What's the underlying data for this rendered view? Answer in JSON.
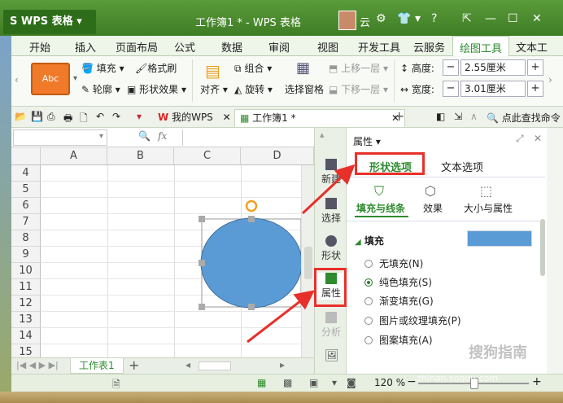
{
  "app": {
    "name": "WPS 表格",
    "doc_title": "工作簿1 * - WPS 表格",
    "user": "云"
  },
  "ribbon_tabs": [
    "开始",
    "插入",
    "页面布局",
    "公式",
    "数据",
    "审阅",
    "视图",
    "开发工具",
    "云服务",
    "绘图工具",
    "文本工"
  ],
  "active_tab": "绘图工具",
  "ribbon": {
    "style_preview": "Abc",
    "fill": "填充",
    "format_painter": "格式刷",
    "outline": "轮廓",
    "shape_effect": "形状效果",
    "align": "对齐",
    "group": "组合",
    "rotate": "旋转",
    "selection_pane": "选择窗格",
    "bring_forward": "上移一层",
    "send_backward": "下移一层",
    "height_label": "高度:",
    "height_value": "2.55厘米",
    "width_label": "宽度:",
    "width_value": "3.01厘米"
  },
  "doc_tabs": {
    "my_wps": "我的WPS",
    "workbook": "工作簿1 *",
    "search_cmd": "点此查找命令"
  },
  "formula_bar": {
    "fx": "fx"
  },
  "grid": {
    "columns": [
      "A",
      "B",
      "C",
      "D"
    ],
    "rows": [
      "4",
      "5",
      "6",
      "7",
      "8",
      "9",
      "10",
      "11",
      "12",
      "13",
      "14",
      "15"
    ]
  },
  "sheet_tab": "工作表1",
  "status": {
    "zoom": "120 %"
  },
  "side_toolbar": [
    "新建",
    "选择",
    "形状",
    "属性",
    "分析"
  ],
  "panel": {
    "title": "属性",
    "tab_shape": "形状选项",
    "tab_text": "文本选项",
    "sub_fill": "填充与线条",
    "sub_effect": "效果",
    "sub_size": "大小与属性",
    "section_fill": "填充",
    "fill_color": "#5b9bd5",
    "options": [
      "无填充(N)",
      "纯色填充(S)",
      "渐变填充(G)",
      "图片或纹理填充(P)",
      "图案填充(A)"
    ],
    "selected_option": "纯色填充(S)"
  },
  "watermark": {
    "cn": "搜狗指南",
    "en": "zhinan.sogou.com"
  },
  "colors": {
    "accent": "#2e8b2e",
    "shape_fill": "#5b9bd5",
    "annotation": "#e8302a"
  }
}
